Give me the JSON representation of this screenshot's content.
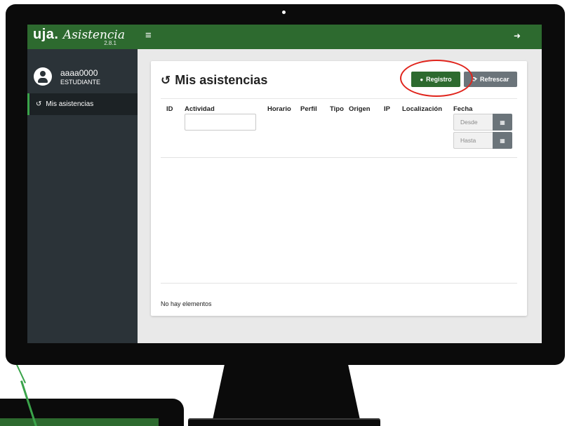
{
  "app": {
    "brand": "uja.",
    "name": "Asistencia",
    "version": "2.8.1"
  },
  "user": {
    "id": "aaaa0000",
    "role": "ESTUDIANTE"
  },
  "sidebar": {
    "items": [
      {
        "label": "Mis asistencias",
        "icon": "history-icon",
        "active": true
      }
    ]
  },
  "topbar": {
    "menu_icon": "hamburger-icon",
    "logout_icon": "sign-out-icon"
  },
  "card": {
    "title": "Mis asistencias",
    "buttons": {
      "registro": "Registro",
      "refrescar": "Refrescar"
    },
    "table": {
      "columns": [
        "ID",
        "Actividad",
        "Horario",
        "Perfil",
        "Tipo",
        "Origen",
        "IP",
        "Localización",
        "Fecha"
      ],
      "filters": {
        "actividad_value": "",
        "fecha_desde_placeholder": "Desde",
        "fecha_hasta_placeholder": "Hasta"
      },
      "empty_message": "No hay elementos"
    }
  },
  "colors": {
    "brand_green": "#2d6a2f",
    "sidebar_dark": "#2b3338",
    "button_gray": "#6b747a",
    "annotation_red": "#e0241c"
  }
}
